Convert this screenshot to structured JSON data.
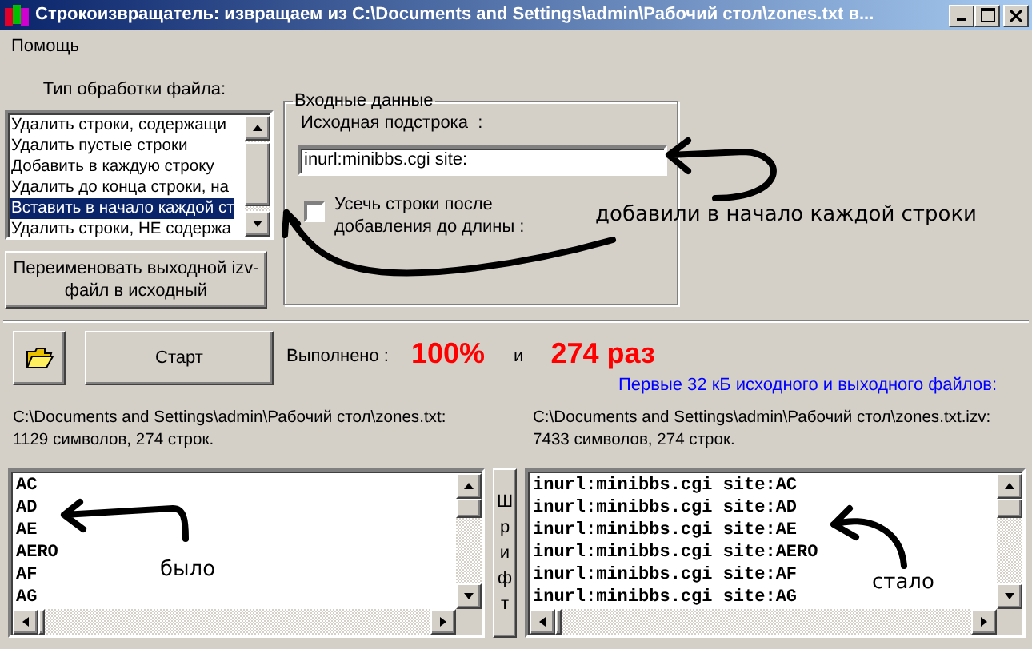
{
  "window": {
    "title": "Строкоизвращатель: извращаем из C:\\Documents and Settings\\admin\\Рабочий стол\\zones.txt в..."
  },
  "menu": [
    {
      "label": "Помощь"
    }
  ],
  "processing_type": {
    "label": "Тип обработки файла:",
    "options": [
      {
        "label": "Удалить строки, содержащи",
        "selected": false
      },
      {
        "label": "Удалить пустые строки",
        "selected": false
      },
      {
        "label": "Добавить в каждую строку",
        "selected": false
      },
      {
        "label": "Удалить до конца строки, на",
        "selected": false
      },
      {
        "label": "Вставить в начало каждой ст",
        "selected": true
      },
      {
        "label": "Удалить строки, НЕ содержа",
        "selected": false
      }
    ]
  },
  "rename_button": "Переименовать выходной izv-файл в исходный",
  "input_data": {
    "label": "Входные данные",
    "substring_label": "Исходная подстрока  :",
    "substring_value": "inurl:minibbs.cgi site:",
    "truncate": {
      "label": "Усечь строки после добавления до длины :",
      "checked": false
    }
  },
  "start_button": "Старт",
  "progress": {
    "label": "Выполнено :",
    "percent": "100%",
    "joiner": "и",
    "count": "274 раз"
  },
  "preview_note": "Первые 32 кБ исходного и выходного файлов:",
  "source": {
    "path": "C:\\Documents and Settings\\admin\\Рабочий стол\\zones.txt:",
    "stats": "1129 символов,  274 строк.",
    "lines": [
      "AC",
      "AD",
      "AE",
      "AERO",
      "AF",
      "AG"
    ]
  },
  "result": {
    "path": "C:\\Documents and Settings\\admin\\Рабочий стол\\zones.txt.izv:",
    "stats": "7433 символов,  274 строк.",
    "lines": [
      "inurl:minibbs.cgi site:AC",
      "inurl:minibbs.cgi site:AD",
      "inurl:minibbs.cgi site:AE",
      "inurl:minibbs.cgi site:AERO",
      "inurl:minibbs.cgi site:AF",
      "inurl:minibbs.cgi site:AG"
    ]
  },
  "font_button": "Шрифт",
  "annotations": [
    {
      "text": "добавили в начало каждой строки"
    },
    {
      "text": "было"
    },
    {
      "text": "стало"
    }
  ]
}
